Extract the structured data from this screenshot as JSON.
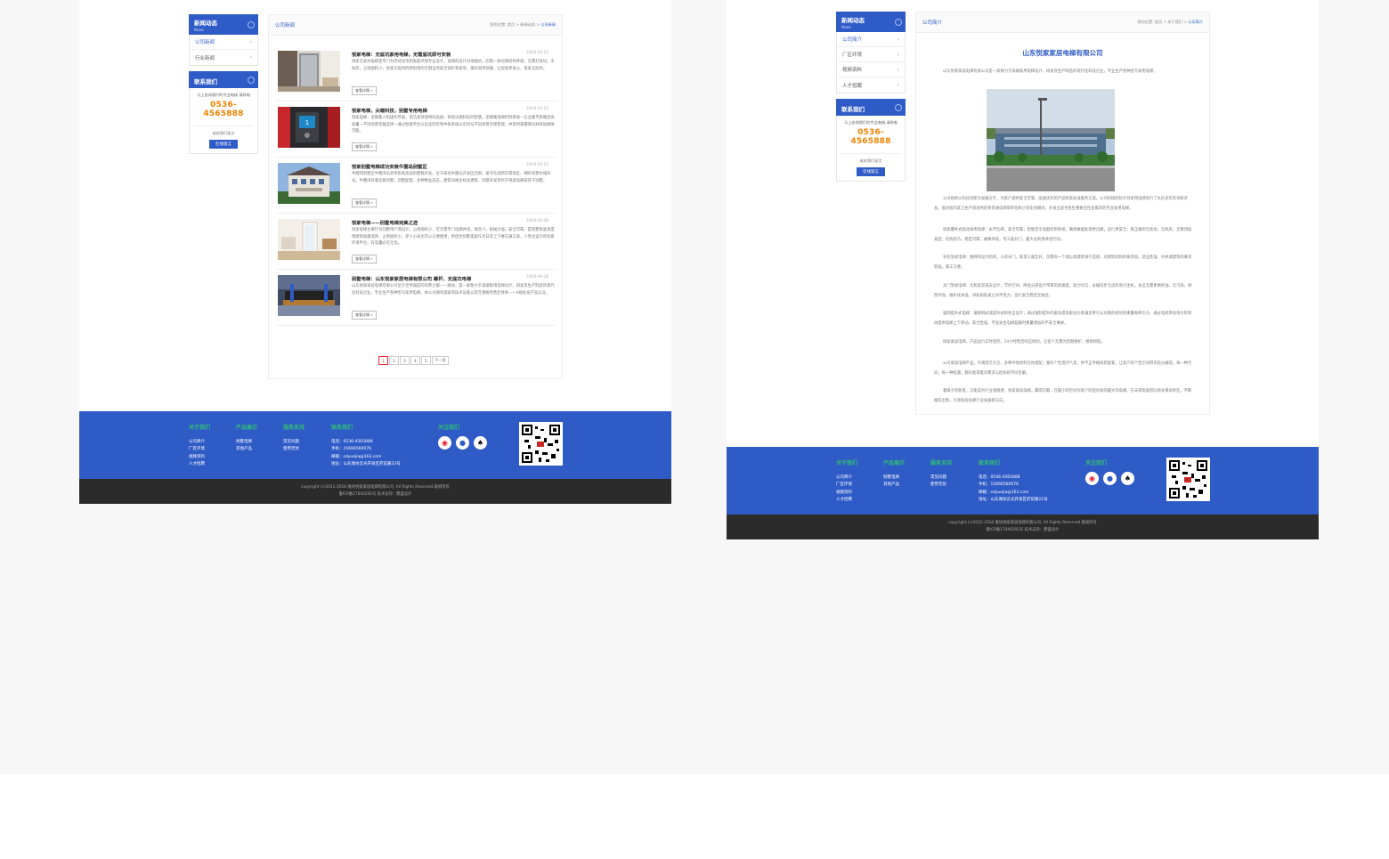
{
  "colors": {
    "brand": "#2f5bc7",
    "phone": "#f08300",
    "footer_heading": "#2fbf71",
    "footer_bottom": "#2b2b2b"
  },
  "left_page": {
    "sidebar": {
      "news_box": {
        "title": "新闻动态",
        "subtitle": "News",
        "items": [
          "公司新闻",
          "行业新闻"
        ]
      },
      "contact_box": {
        "title": "联系我们",
        "tip": "马上咨询我们的专业电梯,请致电",
        "phone": "0536-4565888",
        "msg": "或给我们留言",
        "button": "在线留言"
      }
    },
    "main": {
      "category": "公司新闻",
      "breadcrumb": {
        "prefix": "您的位置: 首页 > 新闻动态 > ",
        "current": "公司新闻"
      },
      "more_label": "查看详情 »",
      "news": [
        {
          "title": "悦家电梯：无底坑家用电梯，无需底坑即可安装",
          "date": "2018-10-15",
          "desc": "悦家无底坑电梯是专门为老式住宅和家庭环境专业设计，电梯的设计对地面坑，因而一体化钢结构井道，无需打底坑，无机房，占地面积小，悦家无底坑的特别用的全钢自然安全保护系统等，操作简单快捷，让悦家更省心，悦家无底坑。"
        },
        {
          "title": "悦家电梯，尖端科技，别墅专用电梯",
          "date": "2018-10-15",
          "desc": "悦家电梯，坐躺集人机操作界面，简洁高效使用的品质，体现尖端科技的智慧。坐躺集电梯控制系统一企业集专家集团高质量一不同场景装载选择一通过智能平台认证化的控制中枢系统以实时与不同场景合理管理，并及时掌握情况并排除故障可能。"
        },
        {
          "title": "悦家别墅电梯成功安装牛圈岛别墅区",
          "date": "2018-10-10",
          "desc": "牛圈湾别墅区牛圈湾岛旁等悦家高层别墅群开发，位于寿光牛圈岛开发区范围，紧邻东部新岸景观区，拥有别墅水域风光，牛圈湾有着优质别墅，别墅配套，多种物业形态，建筑风格多样化建筑，别墅开发项目于悦家电梯安装于别墅。"
        },
        {
          "title": "悦家电梯——别墅电梯完美之选",
          "date": "2018-10-08",
          "desc": "悦家电梯主要针对别墅用户而设计，占用面积小，可无需专门电梯井道，噪音小，耐候力强，安全可靠。是别墅家庭高度理想的电梯选择，占用面积小，老人小孩也可以方便使用，更适合别墅家庭作为日常上下楼交通工具，人性化设计的优质环境平台，有电量必可无忧。"
        },
        {
          "title": "别墅电梯：山东悦家家居电梯有限公司 螺杆、无底坑电梯",
          "date": "2018-09-28",
          "desc": "山东悦家家居电梯有限公司位于世界面前的风筝之都——潍坊，是一家致力于高端家用电梯设计、研发及生产制造的现代化科技企业，专业生产各种型号家用电梯。本公司拥有国家的技术设备以及完善服务售后体系——A级标准产品认证。"
        }
      ],
      "pagination": [
        "1",
        "2",
        "3",
        "4",
        "5",
        "下一页"
      ]
    }
  },
  "right_page": {
    "sidebar": {
      "about_box": {
        "title": "新闻动态",
        "subtitle": "News",
        "items": [
          "公司简介",
          "厂区环境",
          "视频资料",
          "人才招聘"
        ]
      },
      "contact_box": {
        "title": "联系我们",
        "tip": "马上咨询我们的专业电梯,请致电",
        "phone": "0536-4565888",
        "msg": "或给我们留言",
        "button": "在线留言"
      }
    },
    "main": {
      "category": "公司简介",
      "breadcrumb": {
        "prefix": "您的位置: 首页 > 关于我们 > ",
        "current": "公司简介"
      },
      "article_title": "山东悦家家居电梯有限公司",
      "paragraphs": [
        "山东悦家家居电梯有限公司是一家致力于高端家用电梯设计、研发及生产制造的现代化科技企业，专业生产各种型号家用电梯。",
        "公司始终以科技创新为发展方针，为客户提供安全可靠、品质优异的产品和高标准服务方案。公司科研团队针对家用电梯进行了长达多年的深研开发，面对国内其它生产商采用的将普通电梯简单化和小型化的模式，开发出适合民生重要且社会需求的专业家用电梯。",
        "悦家螺杆式驱动家用电梯：永不坠梯，安全可靠；智能型全电脑控制系统，确保数据处理更迅捷，运行更安全；真正做到无底坑，无机房，无需顶层高度；结构轻巧，稳定可靠，故障率低，可三面开门，最大化利用井道空间。",
        "背包架式电梯：独特的设计结构，小房开门，家里三面全开，仅需有一个墙与现建筑进行连接，对建筑结构的要求低，适应性强，对井道建筑的要求较低，施工方便。",
        "龙门架式电梯：无机房双滚支设计，节约空间，降低分部设计带来的高难度，吸力均匀，永磁同步无齿轮曳引主机，永远无需更换机油，无污染，绿色环保，维护成本低，导轨和轨道之间不受力，运行安全稳定无噪音。",
        "强制提升式电梯：兼顾制式或提升式的各自设计，通过强制提升的驱动提高驱动力来满足牵引与对重的相对的重量和牵引力，通过电机带动曳引轮转动提供电梯上下移动。安全性强，不会发生电梯超载时重量增加的不安全事故。",
        "悦家家居电梯，产品运行实时监控，24小时售后响应机制，让客户无需为后期维护，维修烦恼。",
        "公司家居电梯产品，外观简洁大方，多种环保材料任你搭配，富有个性现代气息，并不正传统家装配套，让客户的个性空间得到充分展现，每一种空间，每一种机遇，都在能得着对需求与结构的不同见解。",
        "着眼于创新者，方能成为行业领跑者；悦家家居电梯，赢得信赖，在最小的空间为客户制造优质的最大的电梯。在未来悦家团队将会秉承责任，不断推陈出新，引领家居电梯行业发展新方向。"
      ]
    }
  },
  "footer": {
    "columns": [
      {
        "heading": "关于我们",
        "items": [
          "公司简介",
          "厂区环境",
          "视频资料",
          "人才招聘"
        ]
      },
      {
        "heading": "产品展示",
        "items": [
          "别墅电梯",
          "其他产品"
        ]
      },
      {
        "heading": "服务支持",
        "items": [
          "常见问题",
          "使用无忧"
        ]
      },
      {
        "heading": "联系我们",
        "items": [
          "电话：0536-4565888",
          "手机：15666560076",
          "邮箱：sdyuejia@163.com",
          "地址：山东潍坊云光开发区府前路22号"
        ]
      }
    ],
    "social_heading": "关注我们",
    "social_icons": [
      "weibo-icon",
      "wechat-icon",
      "qq-icon"
    ],
    "copyright_line1": "copyright (c)2012-2018 潍坊悦家家居电梯有限公司. All Rights Reserved.版权所有",
    "copyright_line2": "鲁ICP备17040292号 技术支持：鼎盛设计"
  }
}
